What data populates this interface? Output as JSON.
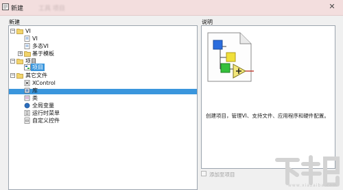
{
  "window": {
    "title": "新建",
    "blurred_subtitle": "工具 项目",
    "close_glyph": "✕"
  },
  "left_panel": {
    "header": "新建"
  },
  "right_panel": {
    "header": "说明",
    "description": "创建项目，管理VI、支持文件、应用程序和硬件配置。",
    "add_to_project_label": "添加至项目"
  },
  "tree": [
    {
      "label": "VI",
      "level": 0,
      "expander": "−",
      "icon": "folder-open"
    },
    {
      "label": "VI",
      "level": 1,
      "expander": "",
      "icon": "vi"
    },
    {
      "label": "多态VI",
      "level": 1,
      "expander": "",
      "icon": "vi"
    },
    {
      "label": "基于模板",
      "level": 1,
      "expander": "+",
      "icon": "folder"
    },
    {
      "label": "项目",
      "level": 0,
      "expander": "−",
      "icon": "folder-open"
    },
    {
      "label": "项目",
      "level": 1,
      "expander": "",
      "icon": "project",
      "selected": true
    },
    {
      "label": "其它文件",
      "level": 0,
      "expander": "−",
      "icon": "folder-open"
    },
    {
      "label": "XControl",
      "level": 1,
      "expander": "",
      "icon": "xcontrol"
    },
    {
      "label": "库",
      "level": 1,
      "expander": "",
      "icon": "library"
    },
    {
      "label": "类",
      "level": 1,
      "expander": "",
      "icon": "class"
    },
    {
      "label": "全局变量",
      "level": 1,
      "expander": "",
      "icon": "global"
    },
    {
      "label": "运行时菜单",
      "level": 1,
      "expander": "",
      "icon": "menu"
    },
    {
      "label": "自定义控件",
      "level": 1,
      "expander": "",
      "icon": "control"
    }
  ],
  "watermark": {
    "text": "下载吧",
    "sub": "www.xiazaiba.com"
  }
}
